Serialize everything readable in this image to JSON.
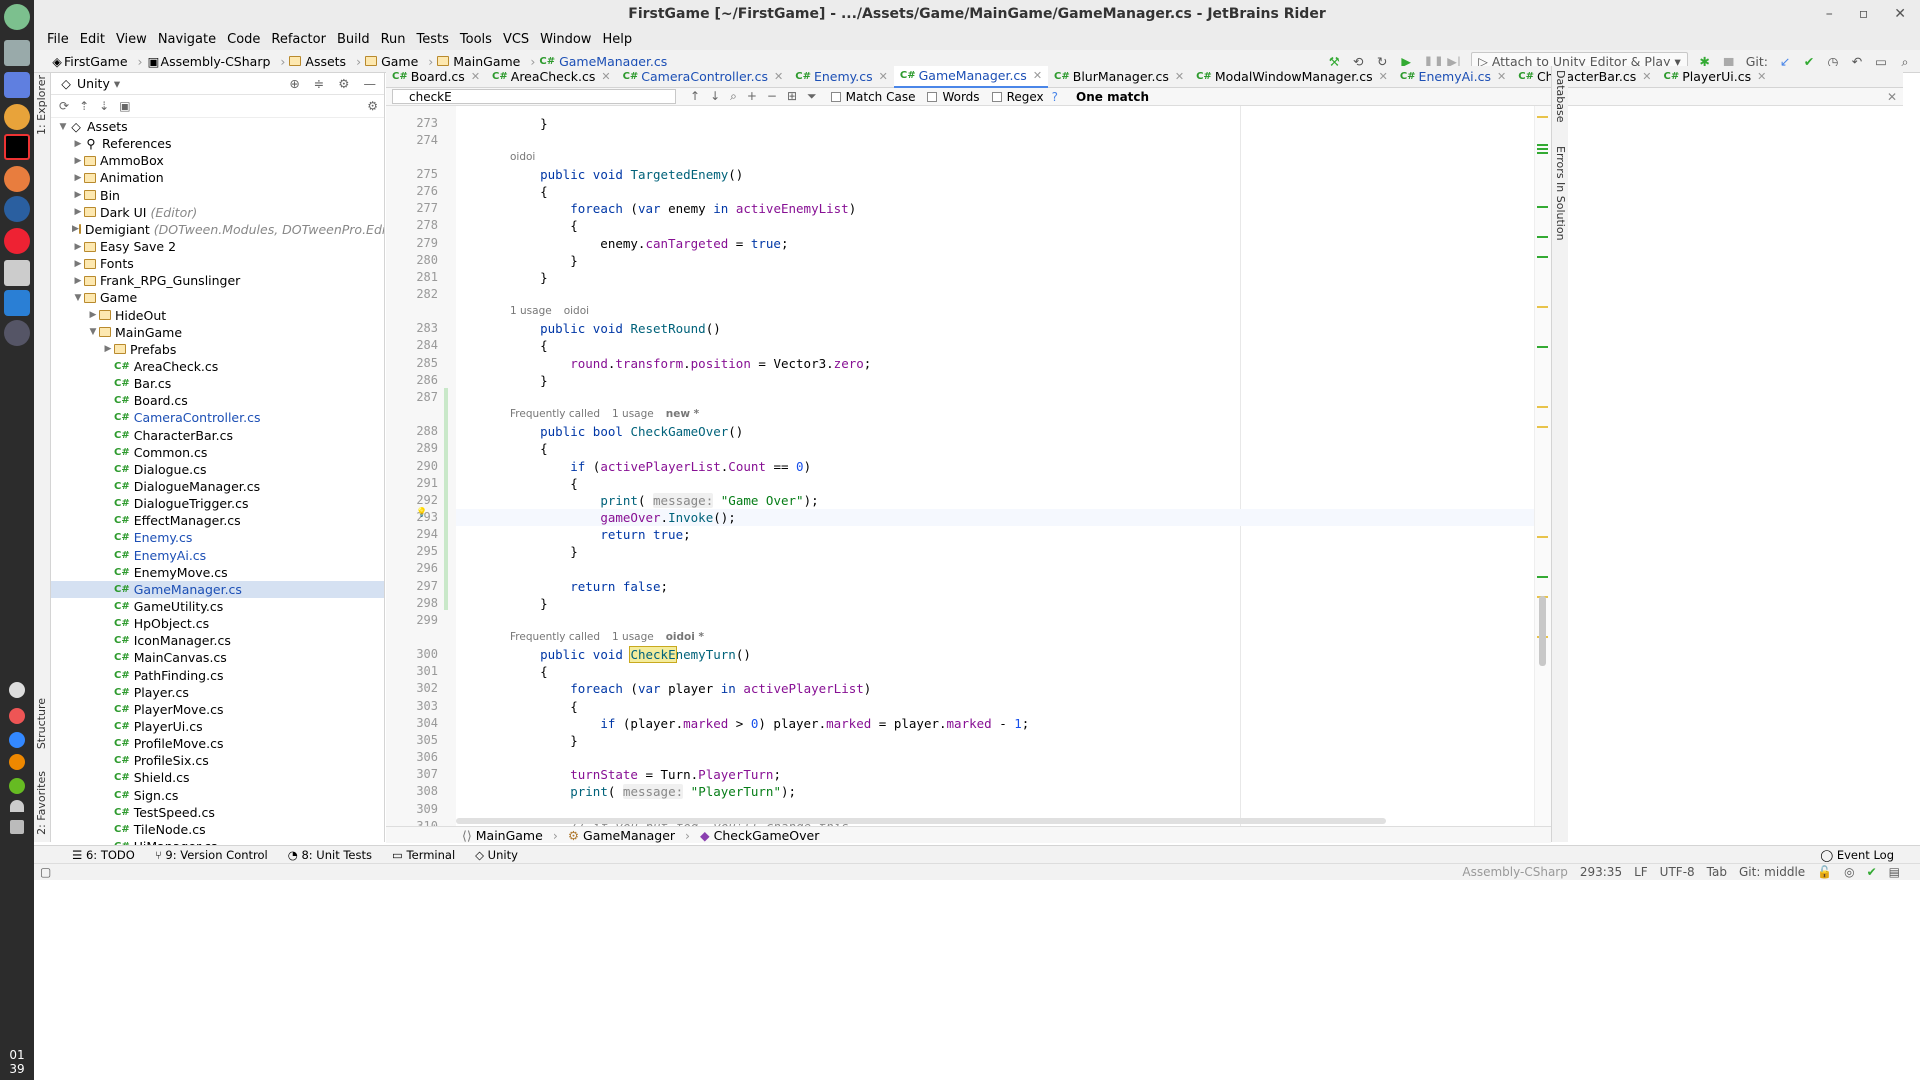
{
  "window": {
    "title": "FirstGame [~/FirstGame] - .../Assets/Game/MainGame/GameManager.cs - JetBrains Rider"
  },
  "dock": {
    "time_h": "01",
    "time_m": "39"
  },
  "menu": [
    "File",
    "Edit",
    "View",
    "Navigate",
    "Code",
    "Refactor",
    "Build",
    "Run",
    "Tests",
    "Tools",
    "VCS",
    "Window",
    "Help"
  ],
  "navbar": {
    "crumbs": [
      "FirstGame",
      "Assembly-CSharp",
      "Assets",
      "Game",
      "MainGame",
      "GameManager.cs"
    ],
    "run_config": "Attach to Unity Editor & Play",
    "git_label": "Git:"
  },
  "project": {
    "title": "Unity",
    "items": [
      {
        "label": "Assets",
        "depth": 0,
        "open": true,
        "kind": "root"
      },
      {
        "label": "References",
        "depth": 1,
        "kind": "ref"
      },
      {
        "label": "AmmoBox",
        "depth": 1,
        "kind": "folder"
      },
      {
        "label": "Animation",
        "depth": 1,
        "kind": "folder"
      },
      {
        "label": "Bin",
        "depth": 1,
        "kind": "folder"
      },
      {
        "label": "Dark UI",
        "hint": "(Editor)",
        "depth": 1,
        "kind": "folder"
      },
      {
        "label": "Demigiant",
        "hint": "(DOTween.Modules, DOTweenPro.EditorScripts, DOTwe",
        "depth": 1,
        "kind": "folder"
      },
      {
        "label": "Easy Save 2",
        "depth": 1,
        "kind": "folder"
      },
      {
        "label": "Fonts",
        "depth": 1,
        "kind": "folder"
      },
      {
        "label": "Frank_RPG_Gunslinger",
        "depth": 1,
        "kind": "folder"
      },
      {
        "label": "Game",
        "depth": 1,
        "open": true,
        "kind": "folder"
      },
      {
        "label": "HideOut",
        "depth": 2,
        "kind": "folder"
      },
      {
        "label": "MainGame",
        "depth": 2,
        "open": true,
        "kind": "folder"
      },
      {
        "label": "Prefabs",
        "depth": 3,
        "kind": "folder"
      },
      {
        "label": "AreaCheck.cs",
        "depth": 3,
        "kind": "cs"
      },
      {
        "label": "Bar.cs",
        "depth": 3,
        "kind": "cs"
      },
      {
        "label": "Board.cs",
        "depth": 3,
        "kind": "cs"
      },
      {
        "label": "CameraController.cs",
        "depth": 3,
        "kind": "cs",
        "mod": true
      },
      {
        "label": "CharacterBar.cs",
        "depth": 3,
        "kind": "cs"
      },
      {
        "label": "Common.cs",
        "depth": 3,
        "kind": "cs"
      },
      {
        "label": "Dialogue.cs",
        "depth": 3,
        "kind": "cs"
      },
      {
        "label": "DialogueManager.cs",
        "depth": 3,
        "kind": "cs"
      },
      {
        "label": "DialogueTrigger.cs",
        "depth": 3,
        "kind": "cs"
      },
      {
        "label": "EffectManager.cs",
        "depth": 3,
        "kind": "cs"
      },
      {
        "label": "Enemy.cs",
        "depth": 3,
        "kind": "cs",
        "mod": true
      },
      {
        "label": "EnemyAi.cs",
        "depth": 3,
        "kind": "cs",
        "mod": true
      },
      {
        "label": "EnemyMove.cs",
        "depth": 3,
        "kind": "cs"
      },
      {
        "label": "GameManager.cs",
        "depth": 3,
        "kind": "cs",
        "mod": true,
        "selected": true
      },
      {
        "label": "GameUtility.cs",
        "depth": 3,
        "kind": "cs"
      },
      {
        "label": "HpObject.cs",
        "depth": 3,
        "kind": "cs"
      },
      {
        "label": "IconManager.cs",
        "depth": 3,
        "kind": "cs"
      },
      {
        "label": "MainCanvas.cs",
        "depth": 3,
        "kind": "cs"
      },
      {
        "label": "PathFinding.cs",
        "depth": 3,
        "kind": "cs"
      },
      {
        "label": "Player.cs",
        "depth": 3,
        "kind": "cs"
      },
      {
        "label": "PlayerMove.cs",
        "depth": 3,
        "kind": "cs"
      },
      {
        "label": "PlayerUi.cs",
        "depth": 3,
        "kind": "cs"
      },
      {
        "label": "ProfileMove.cs",
        "depth": 3,
        "kind": "cs"
      },
      {
        "label": "ProfileSix.cs",
        "depth": 3,
        "kind": "cs"
      },
      {
        "label": "Shield.cs",
        "depth": 3,
        "kind": "cs"
      },
      {
        "label": "Sign.cs",
        "depth": 3,
        "kind": "cs"
      },
      {
        "label": "TestSpeed.cs",
        "depth": 3,
        "kind": "cs"
      },
      {
        "label": "TileNode.cs",
        "depth": 3,
        "kind": "cs"
      },
      {
        "label": "UiManager.cs",
        "depth": 3,
        "kind": "cs"
      }
    ]
  },
  "tabs": [
    {
      "label": "Board.cs"
    },
    {
      "label": "AreaCheck.cs"
    },
    {
      "label": "CameraController.cs",
      "mod": true
    },
    {
      "label": "Enemy.cs",
      "mod": true
    },
    {
      "label": "GameManager.cs",
      "active": true,
      "mod": true
    },
    {
      "label": "BlurManager.cs"
    },
    {
      "label": "ModalWindowManager.cs"
    },
    {
      "label": "EnemyAi.cs",
      "mod": true
    },
    {
      "label": "CharacterBar.cs"
    },
    {
      "label": "PlayerUi.cs"
    }
  ],
  "find": {
    "query": "checkE",
    "match_case": "Match Case",
    "words": "Words",
    "regex": "Regex",
    "help": "?",
    "result": "One match"
  },
  "side_tabs": {
    "explorer": "1: Explorer",
    "structure": "Structure",
    "favorites": "2: Favorites",
    "database": "Database",
    "errors": "Errors In Solution"
  },
  "code": [
    {
      "n": "273",
      "t": "    }"
    },
    {
      "n": "274",
      "t": ""
    },
    {
      "lens": [
        "oidoi"
      ]
    },
    {
      "n": "275",
      "t": "    public void TargetedEnemy()"
    },
    {
      "n": "276",
      "t": "    {"
    },
    {
      "n": "277",
      "t": "        foreach (var enemy in activeEnemyList)"
    },
    {
      "n": "278",
      "t": "        {"
    },
    {
      "n": "279",
      "t": "            enemy.canTargeted = true;"
    },
    {
      "n": "280",
      "t": "        }"
    },
    {
      "n": "281",
      "t": "    }"
    },
    {
      "n": "282",
      "t": ""
    },
    {
      "lens": [
        "1 usage",
        "oidoi"
      ]
    },
    {
      "n": "283",
      "t": "    public void ResetRound()"
    },
    {
      "n": "284",
      "t": "    {"
    },
    {
      "n": "285",
      "t": "        round.transform.position = Vector3.zero;"
    },
    {
      "n": "286",
      "t": "    }"
    },
    {
      "n": "287",
      "t": ""
    },
    {
      "lens": [
        "Frequently called",
        "1 usage",
        "new *"
      ]
    },
    {
      "n": "288",
      "t": "    public bool CheckGameOver()"
    },
    {
      "n": "289",
      "t": "    {"
    },
    {
      "n": "290",
      "t": "        if (activePlayerList.Count == 0)"
    },
    {
      "n": "291",
      "t": "        {"
    },
    {
      "n": "292",
      "t": "            print( message: \"Game Over\");"
    },
    {
      "n": "293",
      "t": "            gameOver.Invoke();",
      "current": true
    },
    {
      "n": "294",
      "t": "            return true;"
    },
    {
      "n": "295",
      "t": "        }"
    },
    {
      "n": "296",
      "t": ""
    },
    {
      "n": "297",
      "t": "        return false;"
    },
    {
      "n": "298",
      "t": "    }"
    },
    {
      "n": "299",
      "t": ""
    },
    {
      "lens": [
        "Frequently called",
        "1 usage",
        "oidoi *"
      ]
    },
    {
      "n": "300",
      "t": "    public void CheckEnemyTurn()"
    },
    {
      "n": "301",
      "t": "    {"
    },
    {
      "n": "302",
      "t": "        foreach (var player in activePlayerList)"
    },
    {
      "n": "303",
      "t": "        {"
    },
    {
      "n": "304",
      "t": "            if (player.marked > 0) player.marked = player.marked - 1;"
    },
    {
      "n": "305",
      "t": "        }"
    },
    {
      "n": "306",
      "t": ""
    },
    {
      "n": "307",
      "t": "        turnState = Turn.PlayerTurn;"
    },
    {
      "n": "308",
      "t": "        print( message: \"PlayerTurn\");"
    },
    {
      "n": "309",
      "t": ""
    },
    {
      "n": "310",
      "t": "        // if you put fog, you'll change this"
    }
  ],
  "breadcrumbs_bottom": [
    "MainGame",
    "GameManager",
    "CheckGameOver"
  ],
  "toolwindows": [
    "6: TODO",
    "9: Version Control",
    "8: Unit Tests",
    "Terminal",
    "Unity"
  ],
  "event_log": "Event Log",
  "status": {
    "assembly": "Assembly-CSharp",
    "pos": "293:35",
    "eol": "LF",
    "enc": "UTF-8",
    "indent": "Tab",
    "git": "Git: middle"
  },
  "colors": {
    "accent": "#4a86e8",
    "keyword": "#0037a6",
    "string": "#067d17",
    "property": "#871094"
  }
}
